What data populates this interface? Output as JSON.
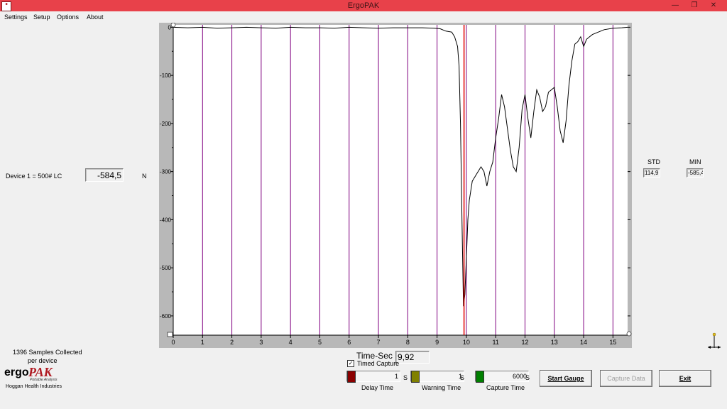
{
  "window": {
    "title": "ErgoPAK",
    "icon_text": "ergo PAK"
  },
  "menu": {
    "items": [
      "Settings",
      "Setup",
      "Options",
      "About"
    ]
  },
  "device": {
    "label": "Device 1 = 500# LC",
    "value": "-584,5",
    "unit": "N"
  },
  "stats": {
    "std_label": "STD",
    "std_value": "114,9",
    "min_label": "MIN",
    "min_value": "-585,4"
  },
  "samples": {
    "line1": "1396 Samples Collected",
    "line2": "per device"
  },
  "brand": {
    "ergo": "ergo",
    "pak": "PAK",
    "tagline": "Portable Analysis",
    "company": "Hoggan Health Industries"
  },
  "time": {
    "label": "Time-Sec",
    "value": "9,92",
    "timed_capture_label": "Timed Capture",
    "timed_capture_checked": true
  },
  "sliders": [
    {
      "value": "1",
      "unit": "S",
      "label": "Delay Time",
      "color": "#8b0000"
    },
    {
      "value": "1",
      "unit": "S",
      "label": "Warning Time",
      "color": "#808000"
    },
    {
      "value": "6000",
      "unit": "S",
      "label": "Capture Time",
      "color": "#008000"
    }
  ],
  "buttons": {
    "start": "Start Gauge",
    "capture": "Capture Data",
    "exit": "Exit"
  },
  "chart_data": {
    "type": "line",
    "xlim": [
      0,
      15.5
    ],
    "ylim": [
      -640,
      5
    ],
    "x_ticks": [
      0,
      1,
      2,
      3,
      4,
      5,
      6,
      7,
      8,
      9,
      10,
      11,
      12,
      13,
      14,
      15
    ],
    "x_tick_labels": [
      "0",
      "1",
      "2",
      "3",
      "4",
      "5",
      "6",
      "7",
      "8",
      "9",
      "10",
      "11",
      "12",
      "13",
      "14",
      "15"
    ],
    "y_ticks": [
      0,
      -100,
      -200,
      -300,
      -400,
      -500,
      -600
    ],
    "y_tick_labels": [
      "0",
      "-100",
      "-200",
      "-300",
      "-400",
      "-500",
      "-600"
    ],
    "grid": "vertical",
    "grid_color": "#800080",
    "cursor_x": 9.92,
    "cursor_color": "#e00000",
    "series": [
      {
        "color": "#000000",
        "x": [
          0,
          0.5,
          1,
          1.5,
          2,
          2.5,
          3,
          3.5,
          4,
          4.5,
          5,
          5.5,
          6,
          6.5,
          7,
          7.5,
          8,
          8.5,
          8.9,
          9.1,
          9.3,
          9.5,
          9.6,
          9.7,
          9.75,
          9.8,
          9.85,
          9.9,
          9.95,
          10.0,
          10.05,
          10.1,
          10.2,
          10.3,
          10.4,
          10.5,
          10.6,
          10.7,
          10.8,
          10.9,
          11.0,
          11.1,
          11.2,
          11.3,
          11.4,
          11.5,
          11.6,
          11.7,
          11.8,
          11.9,
          12.0,
          12.1,
          12.2,
          12.3,
          12.4,
          12.5,
          12.6,
          12.7,
          12.8,
          12.9,
          13.0,
          13.1,
          13.2,
          13.3,
          13.4,
          13.5,
          13.6,
          13.7,
          13.8,
          13.9,
          14.0,
          14.1,
          14.2,
          14.3,
          14.5,
          14.7,
          15.0,
          15.3,
          15.5
        ],
        "y": [
          0,
          -1,
          0,
          -2,
          -1,
          0,
          -1,
          -2,
          0,
          -1,
          -1,
          -2,
          0,
          -1,
          -2,
          -1,
          -1,
          -1,
          -2,
          -3,
          -8,
          -10,
          -20,
          -40,
          -80,
          -200,
          -400,
          -580,
          -555,
          -480,
          -400,
          -360,
          -320,
          -310,
          -300,
          -290,
          -300,
          -330,
          -300,
          -280,
          -230,
          -190,
          -140,
          -165,
          -210,
          -255,
          -290,
          -300,
          -250,
          -170,
          -140,
          -190,
          -230,
          -175,
          -130,
          -145,
          -175,
          -165,
          -135,
          -130,
          -125,
          -165,
          -215,
          -240,
          -195,
          -120,
          -70,
          -35,
          -30,
          -20,
          -40,
          -25,
          -20,
          -15,
          -10,
          -5,
          -2,
          -1,
          0
        ]
      }
    ]
  }
}
